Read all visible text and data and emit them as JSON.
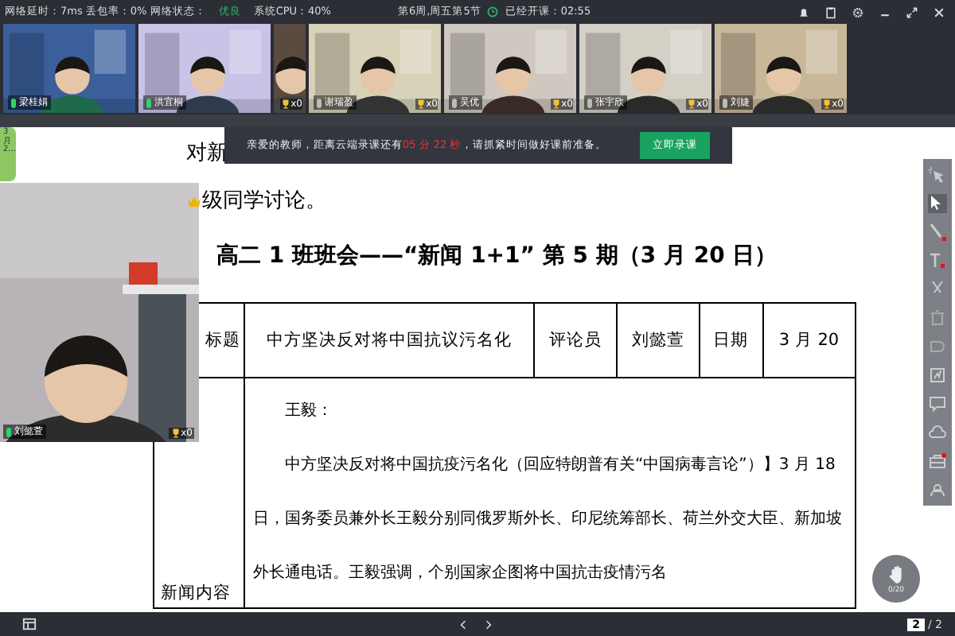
{
  "top_bar": {
    "network_stats": "网络延时：7ms  丢包率：0%  网络状态：",
    "network_status": "优良",
    "cpu": "系统CPU：40%",
    "schedule": "第6周,周五第5节",
    "elapsed": "已经开课：02:55"
  },
  "video_tiles": [
    {
      "kind": "full",
      "name": "梁桂娟",
      "mic_on": true
    },
    {
      "kind": "full",
      "name": "洪宜桐",
      "mic_on": true
    },
    {
      "kind": "partial",
      "trophies": "x0"
    },
    {
      "kind": "full",
      "name": "谢瑞盈",
      "mic_on": false,
      "trophies": "x0"
    },
    {
      "kind": "full",
      "name": "吴优",
      "mic_on": false,
      "trophies": "x0"
    },
    {
      "kind": "full",
      "name": "张宇欣",
      "mic_on": false,
      "trophies": "x0"
    },
    {
      "kind": "full",
      "name": "刘婕",
      "mic_on": false,
      "trophies": "x0"
    }
  ],
  "side_tab": "3月2...",
  "notice": {
    "before": "亲爱的教师，距离云端录课还有",
    "countdown": "05 分 22 秒",
    "after": "，请抓紧时间做好课前准备。",
    "button": "立即录课"
  },
  "document": {
    "lines": [
      "对新",
      "级同学讨论。"
    ],
    "title": "高二 1 班班会——“新闻 1+1” 第 5 期（3 月 20 日）",
    "header_cells": [
      "标题",
      "中方坚决反对将中国抗议污名化",
      "评论员",
      "刘懿萱",
      "日期",
      "3 月 20"
    ],
    "row_label": "新闻内容",
    "paragraphs": [
      "王毅：",
      "中方坚决反对将中国抗疫污名化（回应特朗普有关“中国病毒言论”）】3 月 18 日，国务委员兼外长王毅分别同俄罗斯外长、印尼统筹部长、荷兰外交大臣、新加坡外长通电话。王毅强调，个别国家企图将中国抗击疫情污名"
    ]
  },
  "floating_video": {
    "name": "刘懿萱",
    "mic_on": true,
    "trophies": "x0"
  },
  "hand_count": "0/20",
  "pager": {
    "current": "2",
    "total": "/ 2"
  }
}
